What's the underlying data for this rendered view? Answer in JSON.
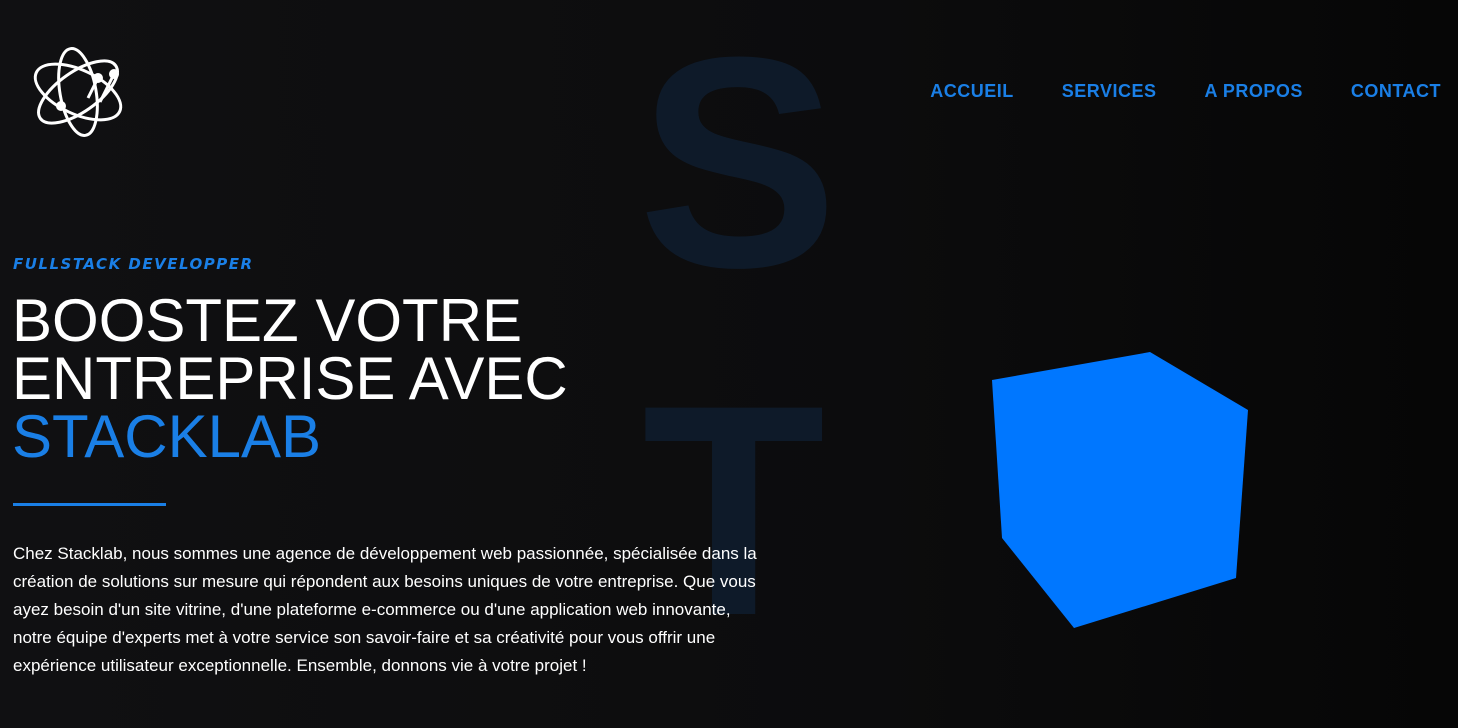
{
  "brand": {
    "logo_icon": "atom-orbit-icon",
    "accent_color": "#1a7fe6",
    "background_color": "#0d0d0e"
  },
  "nav": {
    "items": [
      {
        "label": "ACCUEIL"
      },
      {
        "label": "SERVICES"
      },
      {
        "label": "A PROPOS"
      },
      {
        "label": "CONTACT"
      }
    ]
  },
  "background_letters": [
    "S",
    "T"
  ],
  "hero": {
    "subtitle": "FULLSTACK DEVELOPPER",
    "headline_line1": "BOOSTEZ VOTRE",
    "headline_line2": "ENTREPRISE AVEC",
    "headline_accent": "STACKLAB",
    "description": "Chez Stacklab, nous sommes une agence de développement web passionnée, spécialisée dans la création de solutions sur mesure qui répondent aux besoins uniques de votre entreprise. Que vous ayez besoin d'un site vitrine, d'une plateforme e-commerce ou d'une application web innovante, notre équipe d'experts met à votre service son savoir-faire et sa créativité pour vous offrir une expérience utilisateur exceptionnelle. Ensemble, donnons vie à votre projet !"
  },
  "visual": {
    "shape": "rotating-cube",
    "color": "#0077ff"
  }
}
